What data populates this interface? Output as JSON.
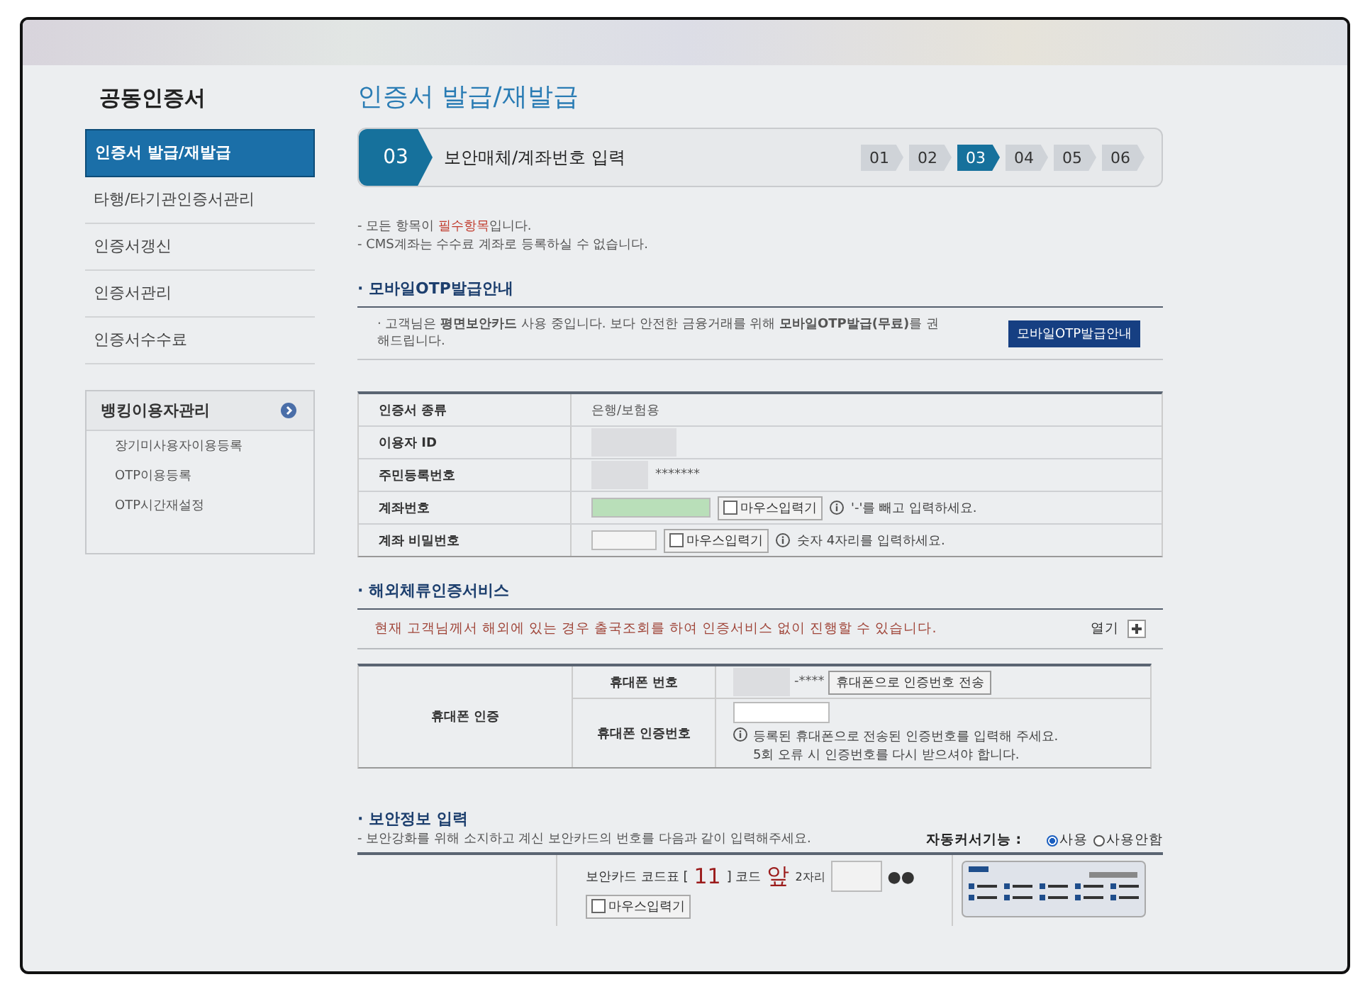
{
  "sidebar": {
    "title": "공동인증서",
    "items": [
      {
        "label": "인증서 발급/재발급",
        "selected": true
      },
      {
        "label": "타행/타기관인증서관리",
        "selected": false
      },
      {
        "label": "인증서갱신",
        "selected": false
      },
      {
        "label": "인증서관리",
        "selected": false
      },
      {
        "label": "인증서수수료",
        "selected": false
      }
    ],
    "panel": {
      "title": "뱅킹이용자관리",
      "items": [
        "장기미사용자이용등록",
        "OTP이용등록",
        "OTP시간재설정"
      ]
    }
  },
  "page_title": "인증서 발급/재발급",
  "step": {
    "number": "03",
    "label": "보안매체/계좌번호 입력",
    "steps": [
      {
        "label": "01",
        "selected": false
      },
      {
        "label": "02",
        "selected": false
      },
      {
        "label": "03",
        "selected": true
      },
      {
        "label": "04",
        "selected": false
      },
      {
        "label": "05",
        "selected": false
      },
      {
        "label": "06",
        "selected": false
      }
    ]
  },
  "notes": [
    "- 모든 항목이 **필수항목**입니다.",
    "- CMS계좌는 수수료 계좌로 등록하실 수 없습니다."
  ],
  "otp": {
    "heading": "· 모바일OTP발급안내",
    "text": "· 고객님은 **평면보안카드** 사용 중입니다. 보다 안전한 금융거래를 위해 **모바일OTP발급(무료)**를 권해드립니다.",
    "button": "모바일OTP발급안내"
  },
  "info_rows": [
    {
      "kind": "text",
      "label": "인증서 종류",
      "value": "은행/보험용"
    },
    {
      "kind": "hidden",
      "label": "이용자 ID"
    },
    {
      "kind": "masked",
      "label": "주민등록번호",
      "value": "*******"
    },
    {
      "kind": "input",
      "label": "계좌번호",
      "filled": true,
      "mouse": {
        "label": "마우스입력기",
        "checked": false
      },
      "hint": "'-'를 빼고 입력하세요."
    },
    {
      "kind": "input",
      "label": "계좌 비밀번호",
      "filled": false,
      "mouse": {
        "label": "마우스입력기",
        "checked": false
      },
      "hint": "숫자 4자리를 입력하세요."
    }
  ],
  "overseas": {
    "heading": "· 해외체류인증서비스",
    "notice": "현재 고객님께서 해외에 있는 경우 출국조회를 하여 인증서비스 없이 진행할 수 있습니다.",
    "toggle": "열기"
  },
  "phone": {
    "group": "휴대폰 인증",
    "number_label": "휴대폰 번호",
    "number_masked": "-****",
    "send_button": "휴대폰으로 인증번호 전송",
    "code_label": "휴대폰 인증번호",
    "code_hints": [
      "등록된 휴대폰으로 전송된 인증번호를 입력해 주세요.",
      "5회 오류 시 인증번호를 다시 받으셔야 합니다."
    ]
  },
  "security": {
    "heading": "· 보안정보 입력",
    "subtitle": "- 보안강화를 위해 소지하고 계신 보안카드의 번호를 다음과 같이 입력해주세요.",
    "auto_label": "자동커서기능 :",
    "options": [
      {
        "label": "사용",
        "selected": true
      },
      {
        "label": "사용안함",
        "selected": false
      }
    ],
    "card_prefix": "보안카드 코드표 [",
    "card_code": "11",
    "card_mid": "] 코드",
    "card_side": "앞",
    "card_digits": "2자리",
    "dots": "●●",
    "mouse": {
      "label": "마우스입력기",
      "checked": false
    }
  }
}
